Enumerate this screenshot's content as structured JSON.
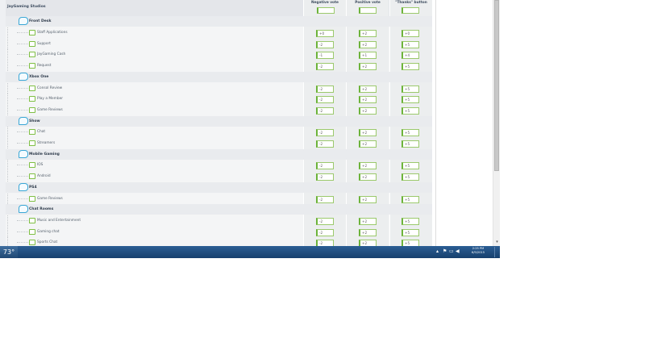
{
  "board": {
    "title": "JayGaming Studios",
    "columns": [
      "Negative vote",
      "Positive vote",
      "\"Thanks\" button"
    ],
    "rows": [
      {
        "type": "category",
        "label": "Front Desk"
      },
      {
        "type": "forum",
        "label": "Staff Applications",
        "neg": "+0",
        "pos": "+2",
        "thanks": "+0"
      },
      {
        "type": "forum",
        "label": "Support",
        "neg": "-2",
        "pos": "+2",
        "thanks": "+5"
      },
      {
        "type": "forum",
        "label": "JayGaming Cash",
        "neg": "-1",
        "pos": "+1",
        "thanks": "+4"
      },
      {
        "type": "forum",
        "label": "Request",
        "neg": "-2",
        "pos": "+2",
        "thanks": "+5"
      },
      {
        "type": "category",
        "label": "Xbox One"
      },
      {
        "type": "forum",
        "label": "Consol Review",
        "neg": "-2",
        "pos": "+2",
        "thanks": "+5"
      },
      {
        "type": "forum",
        "label": "Play a Member",
        "neg": "-2",
        "pos": "+2",
        "thanks": "+5"
      },
      {
        "type": "forum",
        "label": "Game Reviews",
        "neg": "-2",
        "pos": "+2",
        "thanks": "+5"
      },
      {
        "type": "category",
        "label": "Show"
      },
      {
        "type": "forum",
        "label": "Chat",
        "neg": "-2",
        "pos": "+2",
        "thanks": "+5"
      },
      {
        "type": "forum",
        "label": "Streamers",
        "neg": "-2",
        "pos": "+2",
        "thanks": "+5"
      },
      {
        "type": "category",
        "label": "Mobile Gaming"
      },
      {
        "type": "forum",
        "label": "IOS",
        "neg": "-2",
        "pos": "+2",
        "thanks": "+5"
      },
      {
        "type": "forum",
        "label": "Android",
        "neg": "-2",
        "pos": "+2",
        "thanks": "+5"
      },
      {
        "type": "category",
        "label": "PS4"
      },
      {
        "type": "forum",
        "label": "Game Reviews",
        "neg": "-2",
        "pos": "+2",
        "thanks": "+5"
      },
      {
        "type": "category",
        "label": "Chat Rooms"
      },
      {
        "type": "forum",
        "label": "Music and Entertainment",
        "neg": "-2",
        "pos": "+2",
        "thanks": "+5"
      },
      {
        "type": "forum",
        "label": "Gaming chat",
        "neg": "-2",
        "pos": "+2",
        "thanks": "+5"
      },
      {
        "type": "forum",
        "label": "Sports Chat",
        "neg": "-2",
        "pos": "+2",
        "thanks": "+5"
      }
    ]
  },
  "icons": {
    "category": "category-folder-icon",
    "forum": "forum-icon"
  },
  "scrollbar": {
    "arrow": "▾"
  },
  "taskbar": {
    "weather": "73°",
    "tray_icons": {
      "chevron": "▴",
      "flag": "⚑",
      "network": "▭",
      "volume": "◀"
    },
    "time": "2:25 PM",
    "date": "6/9/2015"
  },
  "colors": {
    "accent_green": "#6cb33a",
    "category_blue": "#3aa7d6",
    "taskbar": "#1f4773"
  }
}
